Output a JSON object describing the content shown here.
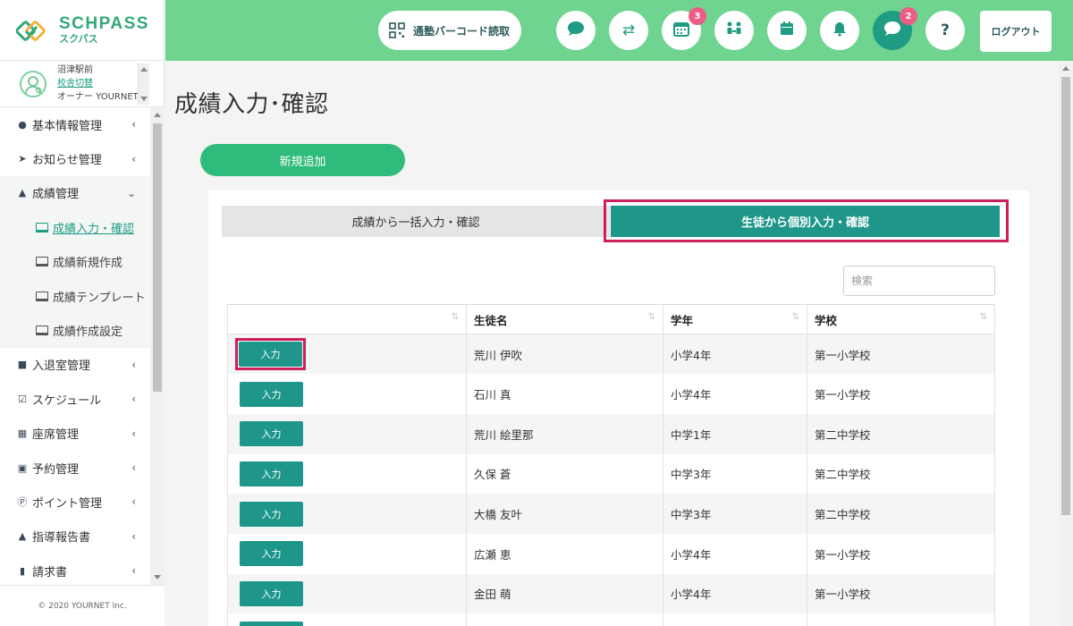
{
  "brand": {
    "name": "SCHPASS",
    "kana": "スクパス"
  },
  "school": {
    "name": "沼津駅前",
    "switch_label": "校舎切替",
    "role": "オーナー YOURNET"
  },
  "sidebar": {
    "items": [
      {
        "label": "基本情報管理",
        "icon": "user-icon"
      },
      {
        "label": "お知らせ管理",
        "icon": "paper-plane-icon"
      },
      {
        "label": "成績管理",
        "icon": "graduation-cap-icon"
      },
      {
        "label": "入退室管理",
        "icon": "car-icon"
      },
      {
        "label": "スケジュール",
        "icon": "calendar-check-icon"
      },
      {
        "label": "座席管理",
        "icon": "grid-calendar-icon"
      },
      {
        "label": "予約管理",
        "icon": "reservation-icon"
      },
      {
        "label": "ポイント管理",
        "icon": "point-icon"
      },
      {
        "label": "指導報告書",
        "icon": "graduation-cap-icon"
      },
      {
        "label": "請求書",
        "icon": "file-icon"
      }
    ],
    "sub_items": [
      {
        "label": "成績入力・確認"
      },
      {
        "label": "成績新規作成"
      },
      {
        "label": "成績テンプレート"
      },
      {
        "label": "成績作成設定"
      }
    ],
    "footer": "© 2020 YOURNET Inc."
  },
  "header": {
    "barcode_label": "通塾バーコード読取",
    "calendar_badge": "3",
    "message_badge": "2",
    "help_label": "?",
    "logout_label": "ログアウト"
  },
  "main": {
    "title": "成績入力･確認",
    "new_button": "新規追加",
    "tabs": [
      {
        "label": "成績から一括入力・確認"
      },
      {
        "label": "生徒から個別入力・確認"
      }
    ],
    "search_placeholder": "検索",
    "table": {
      "headers": [
        "",
        "生徒名",
        "学年",
        "学校"
      ],
      "button_label": "入力",
      "rows": [
        {
          "name": "荒川 伊吹",
          "grade": "小学4年",
          "school": "第一小学校"
        },
        {
          "name": "石川 真",
          "grade": "小学4年",
          "school": "第一小学校"
        },
        {
          "name": "荒川 絵里那",
          "grade": "中学1年",
          "school": "第二中学校"
        },
        {
          "name": "久保 蒼",
          "grade": "中学3年",
          "school": "第二中学校"
        },
        {
          "name": "大橋 友叶",
          "grade": "中学3年",
          "school": "第二中学校"
        },
        {
          "name": "広瀬 恵",
          "grade": "小学4年",
          "school": "第一小学校"
        },
        {
          "name": "金田 萌",
          "grade": "小学4年",
          "school": "第一小学校"
        }
      ]
    }
  },
  "colors": {
    "header_green": "#6fd490",
    "teal": "#1e978a",
    "accent_pink": "#cc1f5b",
    "new_button_green": "#2fbb7c"
  }
}
